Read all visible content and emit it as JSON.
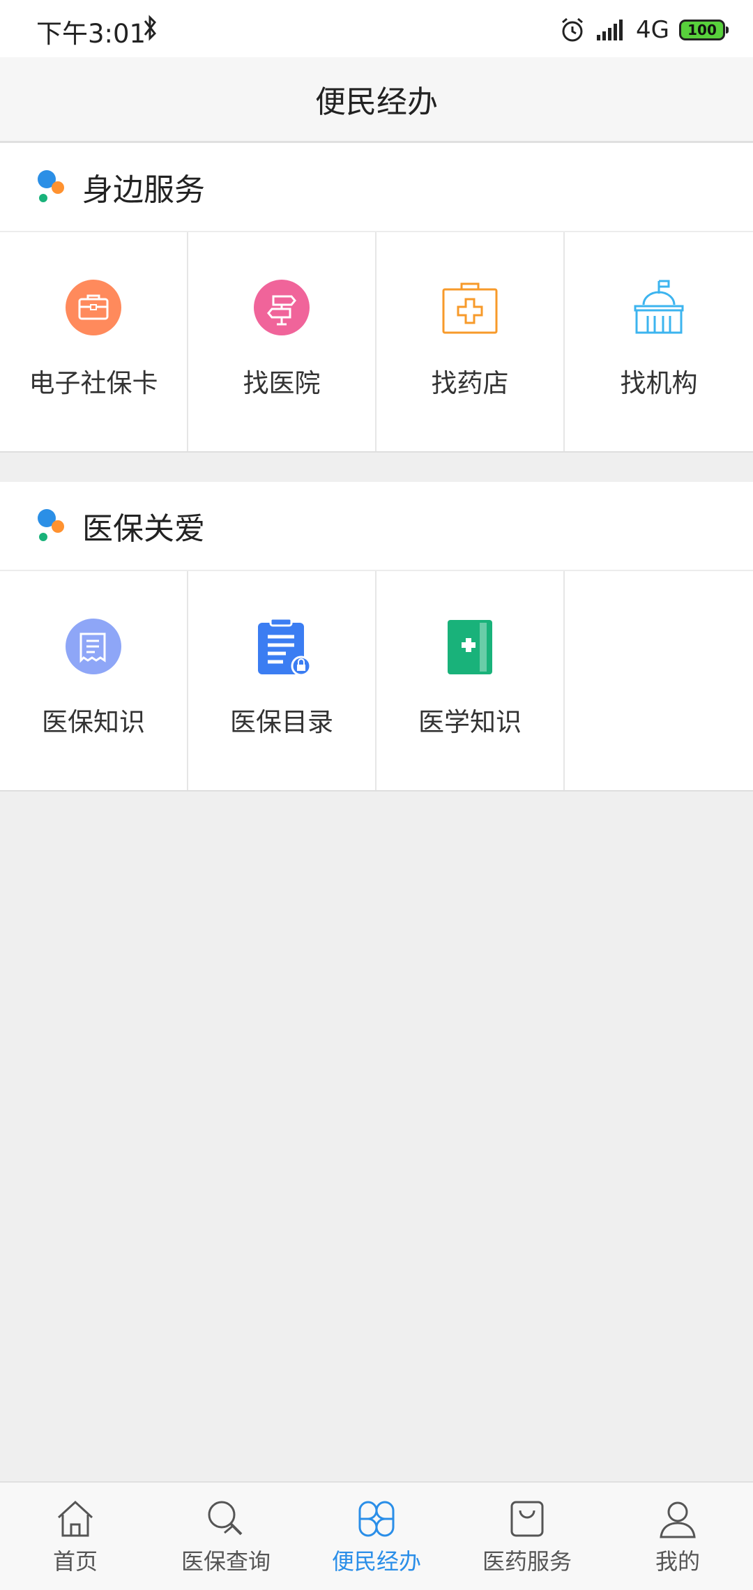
{
  "status_bar": {
    "time": "下午3:01",
    "network": "4G",
    "battery": "100"
  },
  "header": {
    "title": "便民经办"
  },
  "sections": [
    {
      "title": "身边服务",
      "items": [
        {
          "label": "电子社保卡",
          "icon": "briefcase-icon",
          "color": "#ff8a5c"
        },
        {
          "label": "找医院",
          "icon": "signpost-icon",
          "color": "#f0649a"
        },
        {
          "label": "找药店",
          "icon": "first-aid-kit-icon",
          "color": "#f79a2a"
        },
        {
          "label": "找机构",
          "icon": "building-icon",
          "color": "#3cb4ef"
        }
      ]
    },
    {
      "title": "医保关爱",
      "items": [
        {
          "label": "医保知识",
          "icon": "document-icon",
          "color": "#8ea6f7"
        },
        {
          "label": "医保目录",
          "icon": "clipboard-icon",
          "color": "#3b7df2"
        },
        {
          "label": "医学知识",
          "icon": "medical-book-icon",
          "color": "#19b27a"
        }
      ]
    }
  ],
  "tab_bar": {
    "active_color": "#2a8ee8",
    "tabs": [
      {
        "label": "首页",
        "icon": "home-icon"
      },
      {
        "label": "医保查询",
        "icon": "search-icon"
      },
      {
        "label": "便民经办",
        "icon": "apps-grid-icon",
        "active": true
      },
      {
        "label": "医药服务",
        "icon": "shopping-bag-icon"
      },
      {
        "label": "我的",
        "icon": "user-icon"
      }
    ]
  }
}
